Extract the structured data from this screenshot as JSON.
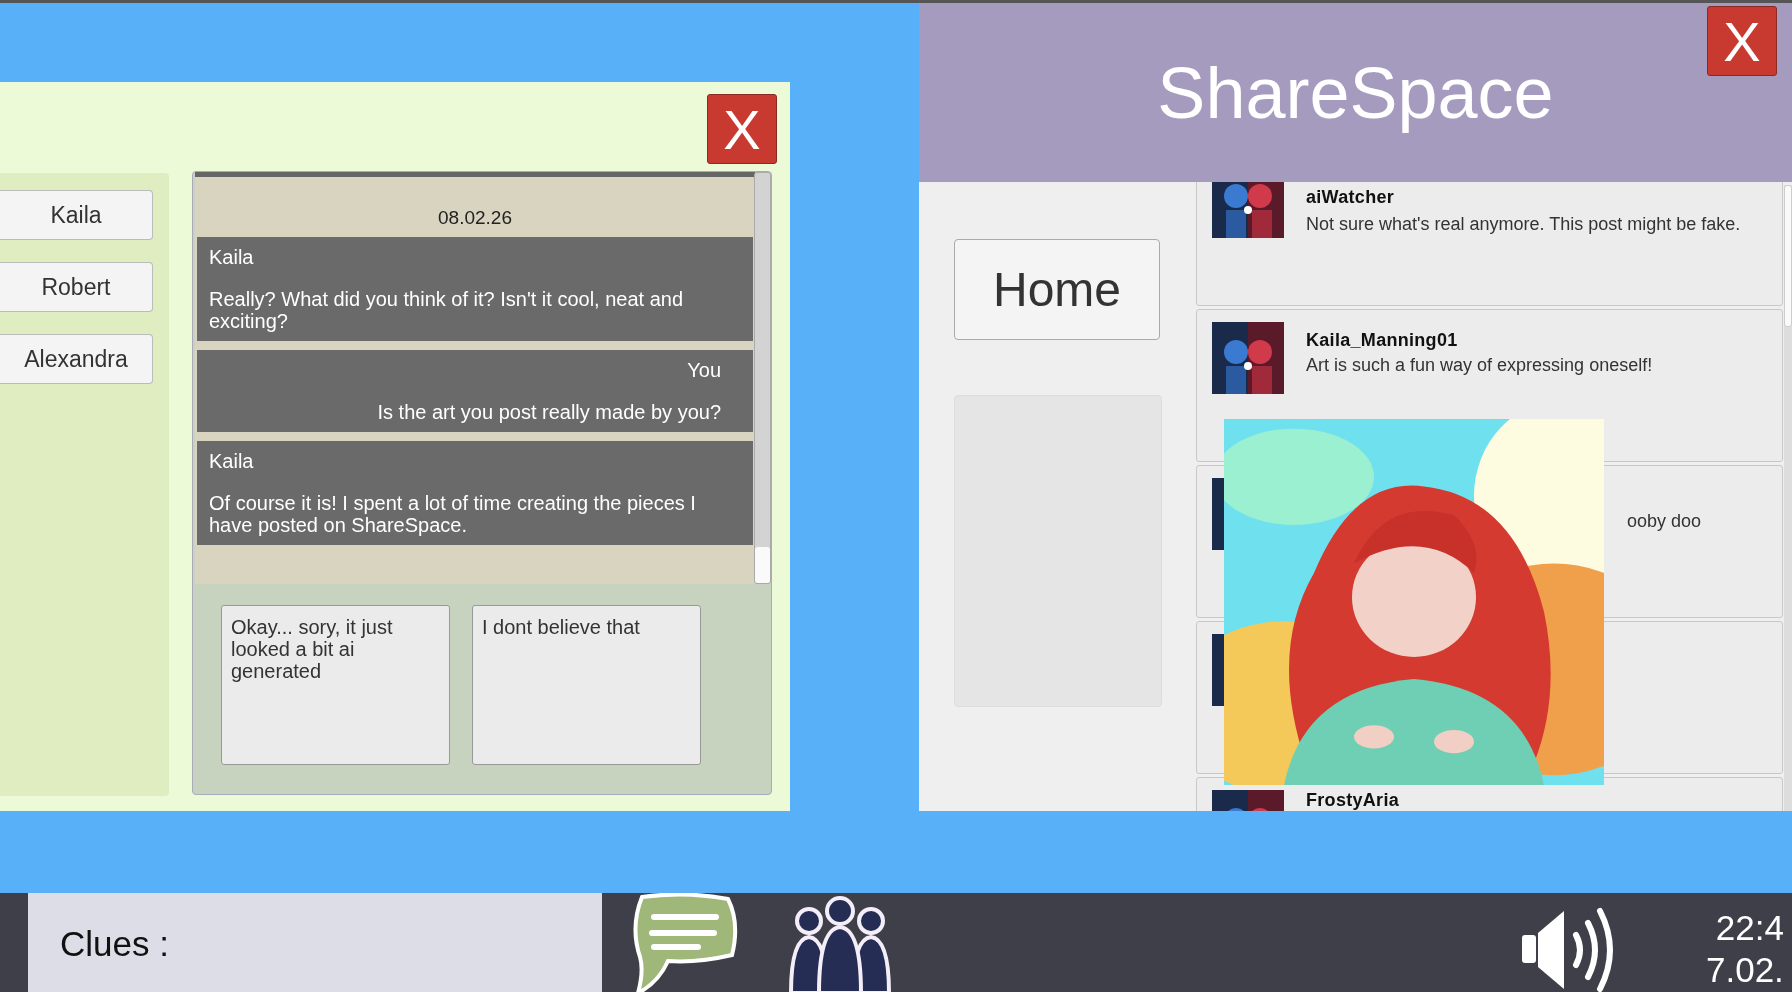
{
  "chat_window": {
    "close": "X",
    "contacts": [
      {
        "name": "Kaila",
        "selected": false
      },
      {
        "name": "Robert",
        "selected": false
      },
      {
        "name": "Alexandra",
        "selected": false
      }
    ],
    "date": "08.02.26",
    "messages": [
      {
        "sender": "Kaila",
        "text": "Really? What did you think of it? Isn't it cool, neat and exciting?",
        "kind": "incoming"
      },
      {
        "sender": "You",
        "text": "Is the art you post really made by you?",
        "kind": "outgoing"
      },
      {
        "sender": "Kaila",
        "text": "Of course it is! I spent a lot of time creating the pieces I have posted on ShareSpace.",
        "kind": "incoming"
      }
    ],
    "replies": [
      "Okay... sory, it just looked a bit ai generated",
      "I dont believe that"
    ]
  },
  "sharespace": {
    "title": "ShareSpace",
    "close": "X",
    "nav": [
      {
        "label": "Home"
      }
    ],
    "posts": [
      {
        "user": "aiWatcher",
        "text": "Not sure what's real anymore. This post might be fake.",
        "kind": "plain"
      },
      {
        "user": "Kaila_Manning01",
        "text": "Art is such a fun way of expressing oneself!",
        "kind": "plain"
      },
      {
        "text": "ooby doo",
        "kind": "covered"
      },
      {
        "kind": "covered"
      },
      {
        "user": "FrostyAria",
        "kind": "plain"
      }
    ]
  },
  "taskbar": {
    "clues_label": "Clues :",
    "time": "22:4",
    "date": "7.02."
  }
}
